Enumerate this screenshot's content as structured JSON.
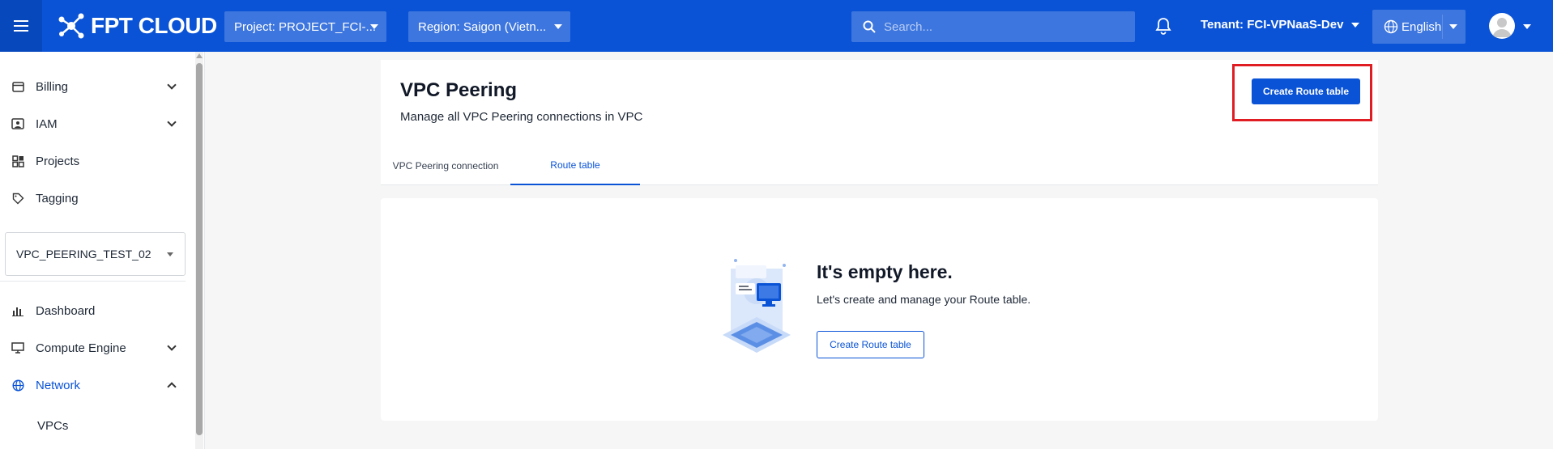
{
  "header": {
    "logo_text": "FPT CLOUD",
    "project_select": "Project: PROJECT_FCI-...",
    "region_select": "Region: Saigon (Vietn...",
    "search_placeholder": "Search...",
    "tenant": "Tenant: FCI-VPNaaS-Dev",
    "language": "English"
  },
  "sidebar": {
    "top_items": [
      {
        "label": "Billing",
        "icon": "billing-icon"
      },
      {
        "label": "IAM",
        "icon": "iam-icon"
      },
      {
        "label": "Projects",
        "icon": "projects-icon"
      },
      {
        "label": "Tagging",
        "icon": "tag-icon"
      }
    ],
    "vpc_select": "VPC_PEERING_TEST_02",
    "items": [
      {
        "label": "Dashboard",
        "icon": "dashboard-icon"
      },
      {
        "label": "Compute Engine",
        "icon": "monitor-icon"
      },
      {
        "label": "Network",
        "icon": "globe-icon"
      }
    ],
    "sub_items": [
      "VPCs"
    ]
  },
  "page": {
    "title": "VPC Peering",
    "subtitle": "Manage all VPC Peering connections in VPC",
    "create_button": "Create Route table",
    "tabs": [
      "VPC Peering connection",
      "Route table"
    ],
    "active_tab": "Route table"
  },
  "empty_state": {
    "title": "It's empty here.",
    "description": "Let's create and manage your Route table.",
    "button": "Create Route table"
  },
  "colors": {
    "brand": "#0a53d6",
    "highlight": "#e11d24"
  }
}
